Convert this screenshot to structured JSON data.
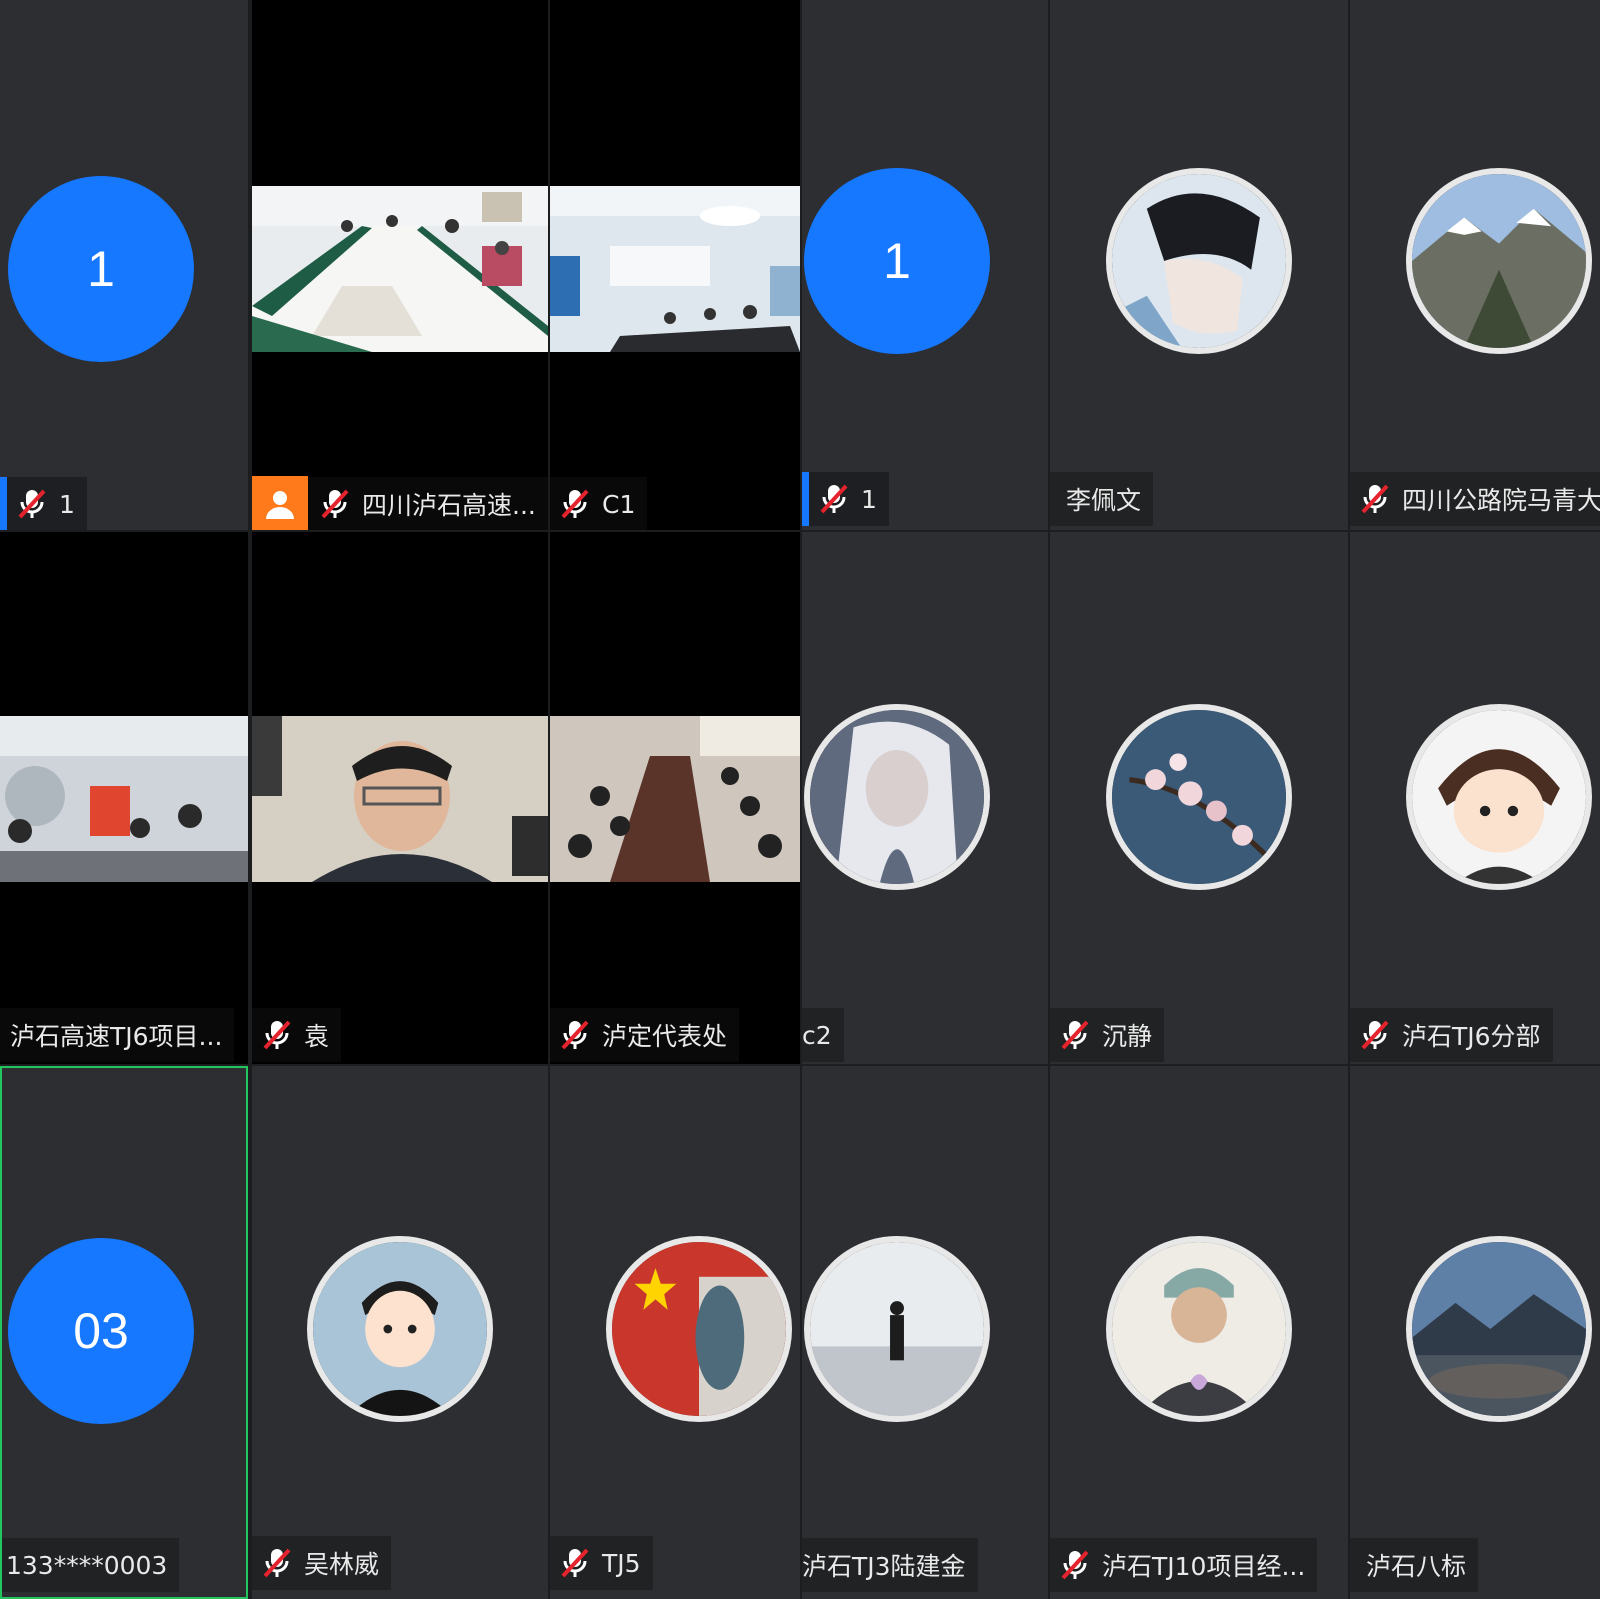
{
  "colors": {
    "tile_bg": "#2c2e31",
    "video_bg": "#000000",
    "accent_blue": "#1677ff",
    "active_border": "#22c55e",
    "muted_mic_red": "#e5232d",
    "host_orange": "#ff7a1a"
  },
  "participants": [
    {
      "id": "p1",
      "name": "1",
      "avatar_text": "1",
      "muted": true
    },
    {
      "id": "p2",
      "name": "四川泸石高速...",
      "muted": true,
      "video": true,
      "host_badge": true
    },
    {
      "id": "p3",
      "name": "C1",
      "muted": true,
      "video": true
    },
    {
      "id": "p4",
      "name": "1",
      "avatar_text": "1",
      "muted": true
    },
    {
      "id": "p5",
      "name": "李佩文",
      "muted": false,
      "avatar_icon": "anime-boy-avatar"
    },
    {
      "id": "p6",
      "name": "四川公路院马青大",
      "muted": true,
      "avatar_icon": "snow-mountain-avatar"
    },
    {
      "id": "p7",
      "name": "泸石高速TJ6项目...",
      "muted": false,
      "video": true
    },
    {
      "id": "p8",
      "name": "袁",
      "muted": true,
      "video": true
    },
    {
      "id": "p9",
      "name": "泸定代表处",
      "muted": true,
      "video": true
    },
    {
      "id": "p10",
      "name": "c2",
      "muted": false,
      "avatar_icon": "white-hair-girl-avatar"
    },
    {
      "id": "p11",
      "name": "沉静",
      "muted": true,
      "avatar_icon": "blossom-branch-avatar"
    },
    {
      "id": "p12",
      "name": "泸石TJ6分部",
      "muted": true,
      "avatar_icon": "cartoon-kid-avatar"
    },
    {
      "id": "p13",
      "name": "133****0003",
      "avatar_text": "03",
      "muted": false
    },
    {
      "id": "p14",
      "name": "吴林威",
      "muted": true,
      "avatar_icon": "cartoon-man-avatar"
    },
    {
      "id": "p15",
      "name": "TJ5",
      "muted": true,
      "avatar_icon": "flag-avatar"
    },
    {
      "id": "p16",
      "name": "泸石TJ3陆建金",
      "muted": false,
      "avatar_icon": "lone-figure-avatar"
    },
    {
      "id": "p17",
      "name": "泸石TJ10项目经...",
      "muted": true,
      "avatar_icon": "beanie-man-avatar"
    },
    {
      "id": "p18",
      "name": "泸石八标",
      "muted": false,
      "avatar_icon": "lake-mountain-avatar"
    }
  ]
}
